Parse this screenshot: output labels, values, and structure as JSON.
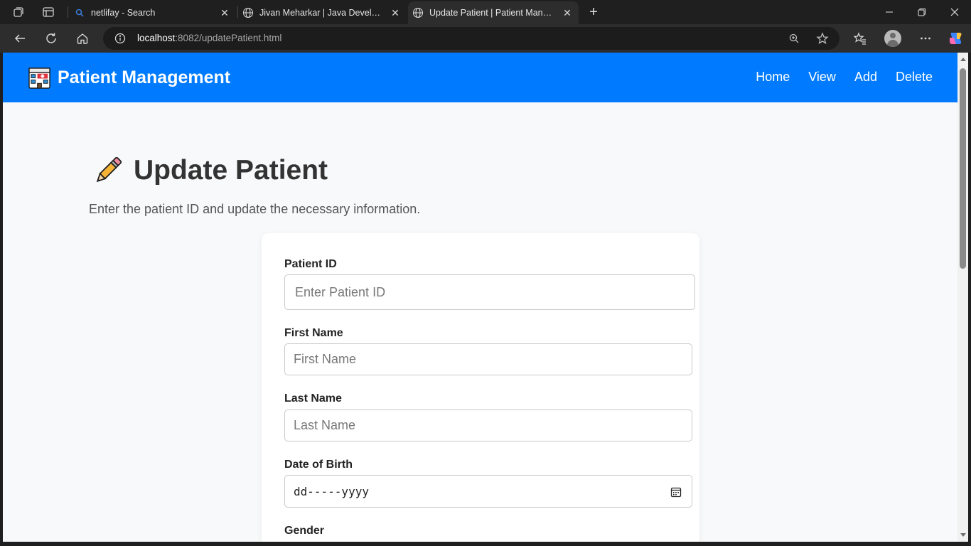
{
  "browser": {
    "tabs": [
      {
        "title": "netlifay - Search",
        "active": false
      },
      {
        "title": "Jivan Meharkar | Java Developer",
        "active": false
      },
      {
        "title": "Update Patient | Patient Management",
        "active": true
      }
    ],
    "url_host": "localhost",
    "url_rest": ":8082/updatePatient.html"
  },
  "nav": {
    "brand": "Patient Management",
    "links": [
      "Home",
      "View",
      "Add",
      "Delete"
    ]
  },
  "page": {
    "title": "Update Patient",
    "subtitle": "Enter the patient ID and update the necessary information."
  },
  "form": {
    "patient_id": {
      "label": "Patient ID",
      "placeholder": "Enter Patient ID",
      "value": ""
    },
    "first_name": {
      "label": "First Name",
      "placeholder": "First Name",
      "value": ""
    },
    "last_name": {
      "label": "Last Name",
      "placeholder": "Last Name",
      "value": ""
    },
    "dob": {
      "label": "Date of Birth",
      "display": "dd-----yyyy"
    },
    "gender": {
      "label": "Gender"
    }
  },
  "colors": {
    "navbar": "#007bff",
    "page_bg": "#f8f9fa",
    "card_bg": "#ffffff",
    "chrome_bg": "#1f1f1f",
    "toolbar_bg": "#2d2d2d"
  }
}
